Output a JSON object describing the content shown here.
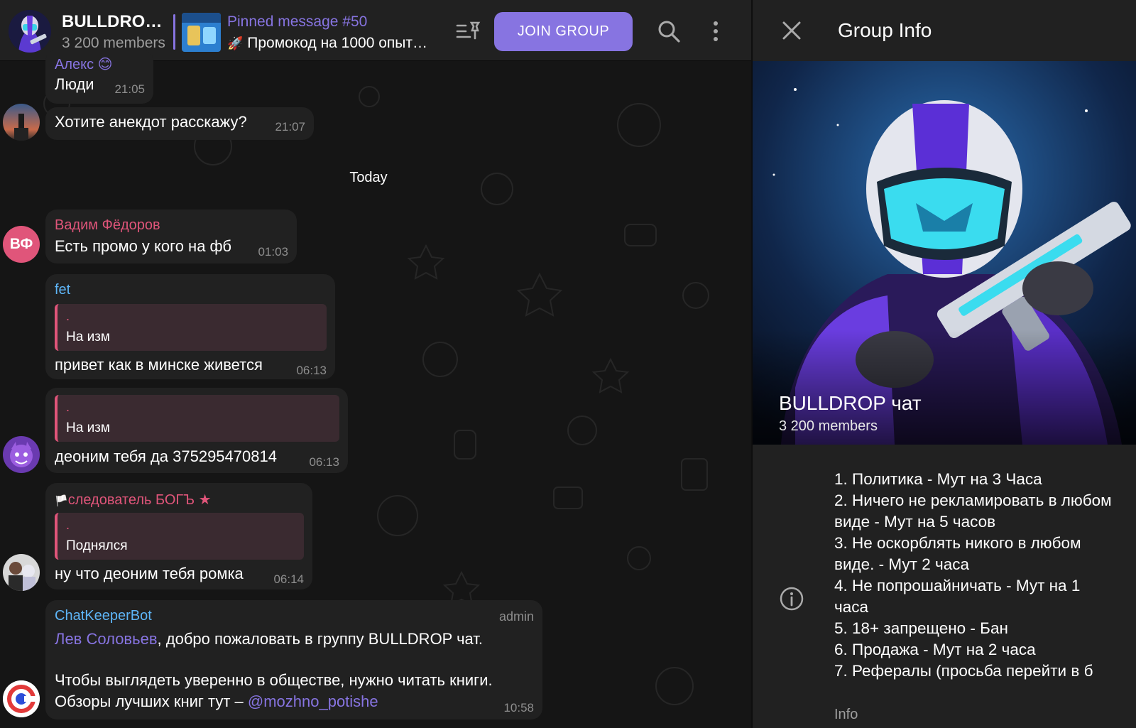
{
  "header": {
    "group_title": "BULLDROP чат",
    "group_subtitle": "3 200 members",
    "pinned_title": "Pinned message #50",
    "pinned_text": "Промокод на 1000 опыт…",
    "join_label": "JOIN GROUP"
  },
  "chat": {
    "date_separator": "Today",
    "messages": [
      {
        "name": "Алекс 😊",
        "text": "Люди",
        "time": "21:05"
      },
      {
        "text": "Хотите анекдот расскажу?",
        "time": "21:07"
      },
      {
        "name": "Вадим Фёдоров",
        "avatar_initials": "ВФ",
        "text": "Есть промо у кого на фб",
        "time": "01:03"
      },
      {
        "name": "fet",
        "reply_dot": ".",
        "reply_text": "На изм",
        "text": "привет как в минске живется",
        "time": "06:13"
      },
      {
        "reply_dot": ".",
        "reply_text": "На изм",
        "text": "деоним тебя да 375295470814",
        "time": "06:13"
      },
      {
        "name": "следователь БОГЪ",
        "reply_dot": ".",
        "reply_text": "Поднялся",
        "text": "ну что деоним тебя ромка",
        "time": "06:14"
      },
      {
        "name": "ChatKeeperBot",
        "badge": "admin",
        "mention": "Лев Соловьев",
        "line1_rest": ", добро пожаловать в группу BULLDROP чат.",
        "line2": "Чтобы выглядеть уверенно в обществе, нужно читать книги.",
        "line3_prefix": "Обзоры лучших книг тут – ",
        "link": "@mozhno_potishe",
        "time": "10:58"
      }
    ]
  },
  "panel": {
    "title": "Group Info",
    "group_name": "BULLDROP чат",
    "members": "3 200 members",
    "rules": [
      "1. Политика - Мут на 3 Часа",
      "2. Ничего не рекламировать в любом виде - Мут на 5 часов",
      "3. Не оскорблять никого в любом виде. - Мут 2 часа",
      "4. Не попрошайничать - Мут на 1 часа",
      "5. 18+ запрещено - Бан",
      "6. Продажа - Мут на 2 часа",
      "7. Рефералы (просьба перейти в б"
    ],
    "info_label": "Info"
  },
  "colors": {
    "accent": "#8774e1",
    "name_pink": "#e0557a",
    "name_blue": "#5eb5f7",
    "link": "#8774e1",
    "bubble": "#212121"
  }
}
